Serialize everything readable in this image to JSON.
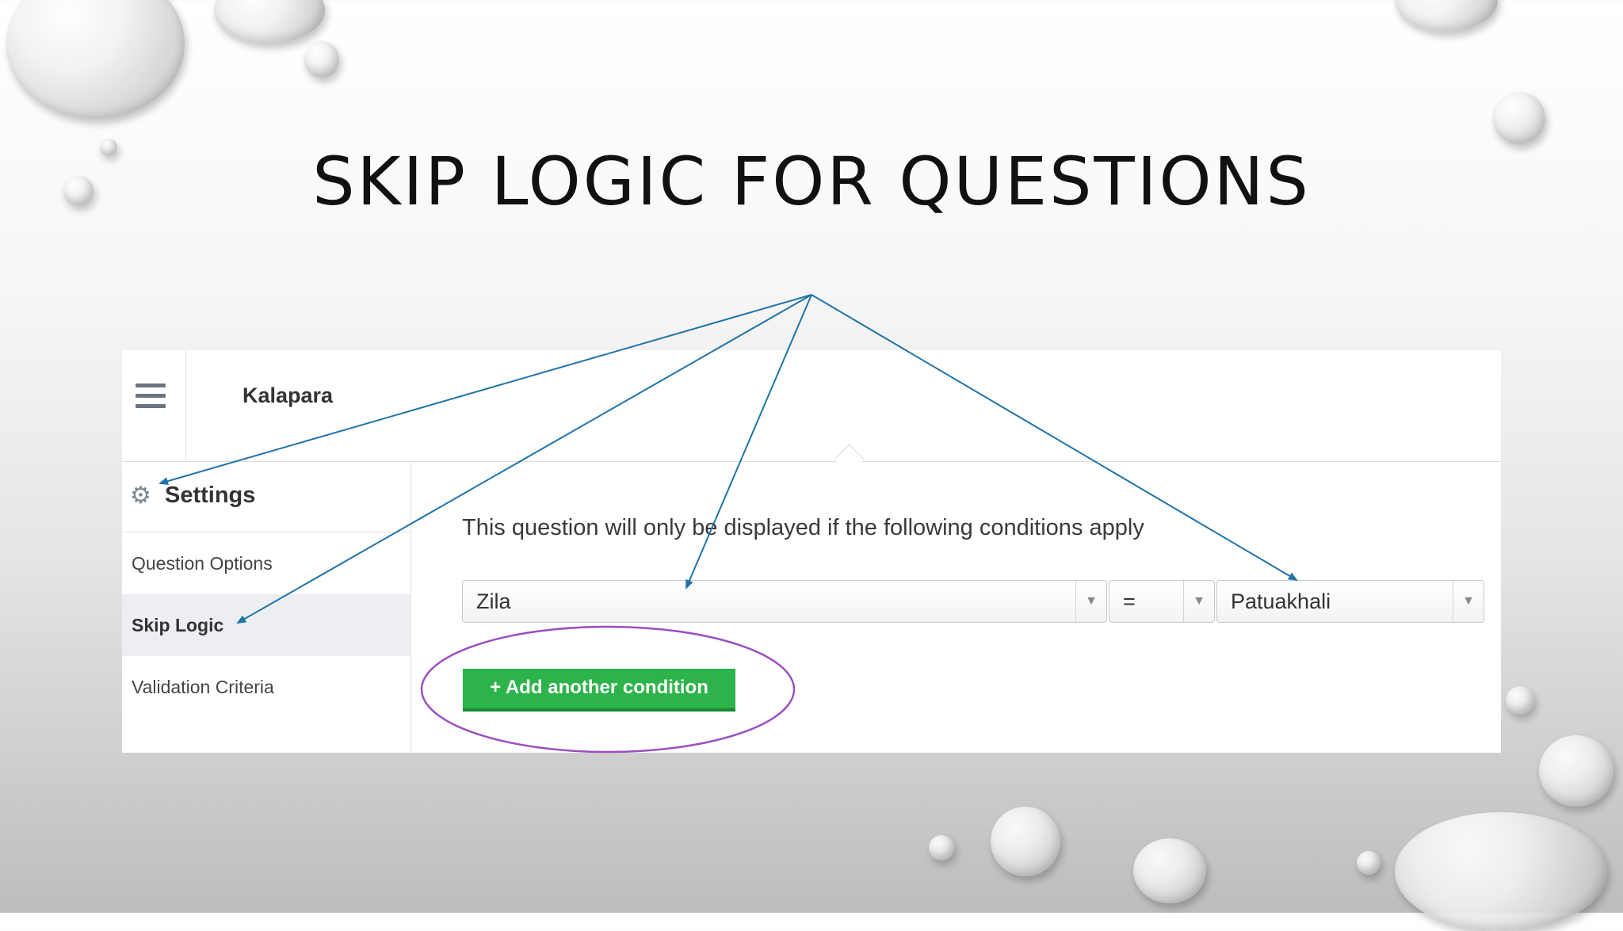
{
  "slide": {
    "title": "SKIP LOGIC FOR QUESTIONS"
  },
  "app": {
    "header": {
      "project_name": "Kalapara",
      "menu_icon": "hamburger-menu-icon"
    },
    "sidebar": {
      "heading": "Settings",
      "heading_icon": "gear-icon",
      "items": [
        {
          "label": "Question Options",
          "active": false
        },
        {
          "label": "Skip Logic",
          "active": true
        },
        {
          "label": "Validation Criteria",
          "active": false
        }
      ]
    },
    "skip_logic": {
      "description": "This question will only be displayed if the following conditions apply",
      "condition": {
        "question": "Zila",
        "operator": "=",
        "value": "Patuakhali"
      },
      "add_button": "+ Add another condition"
    }
  },
  "colors": {
    "add_button": "#2cb34a",
    "annotation_arrows": "#1f74a8",
    "annotation_ellipse": "#9b4fc0"
  }
}
